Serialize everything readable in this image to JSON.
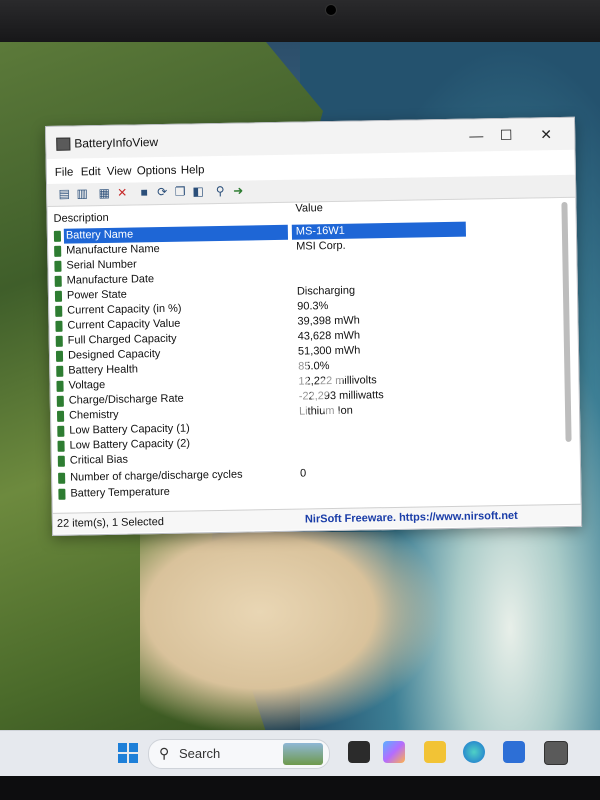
{
  "window": {
    "title": "BatteryInfoView",
    "controls": {
      "minimize": "—",
      "maximize": "☐",
      "close": "✕"
    }
  },
  "menu": [
    "File",
    "Edit",
    "View",
    "Options",
    "Help"
  ],
  "columns": {
    "description": "Description",
    "value": "Value"
  },
  "rows": [
    {
      "description": "Battery Name",
      "value": "MS-16W1",
      "selected": true
    },
    {
      "description": "Manufacture Name",
      "value": "MSI Corp."
    },
    {
      "description": "Serial Number",
      "value": ""
    },
    {
      "description": "Manufacture Date",
      "value": ""
    },
    {
      "description": "Power State",
      "value": "Discharging"
    },
    {
      "description": "Current Capacity (in %)",
      "value": "90.3%"
    },
    {
      "description": "Current Capacity Value",
      "value": "39,398 mWh"
    },
    {
      "description": "Full Charged Capacity",
      "value": "43,628 mWh"
    },
    {
      "description": "Designed Capacity",
      "value": "51,300 mWh"
    },
    {
      "description": "Battery Health",
      "value": "85.0%"
    },
    {
      "description": "Voltage",
      "value": "12,222 millivolts"
    },
    {
      "description": "Charge/Discharge Rate",
      "value": "-22,293 milliwatts"
    },
    {
      "description": "Chemistry",
      "value": "Lithium Ion"
    },
    {
      "description": "Low Battery Capacity (1)",
      "value": ""
    },
    {
      "description": "Low Battery Capacity (2)",
      "value": ""
    },
    {
      "description": "Critical Bias",
      "value": ""
    },
    {
      "description": "Number of charge/discharge cycles",
      "value": "0"
    },
    {
      "description": "Battery Temperature",
      "value": ""
    }
  ],
  "status": {
    "items": "22 item(s), 1 Selected",
    "credit": "NirSoft Freeware. https://www.nirsoft.net"
  },
  "taskbar": {
    "search_label": "Search",
    "icons": [
      "windows-start-icon",
      "search-icon",
      "task-view-icon",
      "copilot-icon",
      "file-explorer-icon",
      "edge-icon",
      "store-icon",
      "battery-app-icon"
    ]
  },
  "colors": {
    "selection": "#1e66d6",
    "credit_link": "#1a3da8",
    "battery_icon": "#2e7d32"
  }
}
